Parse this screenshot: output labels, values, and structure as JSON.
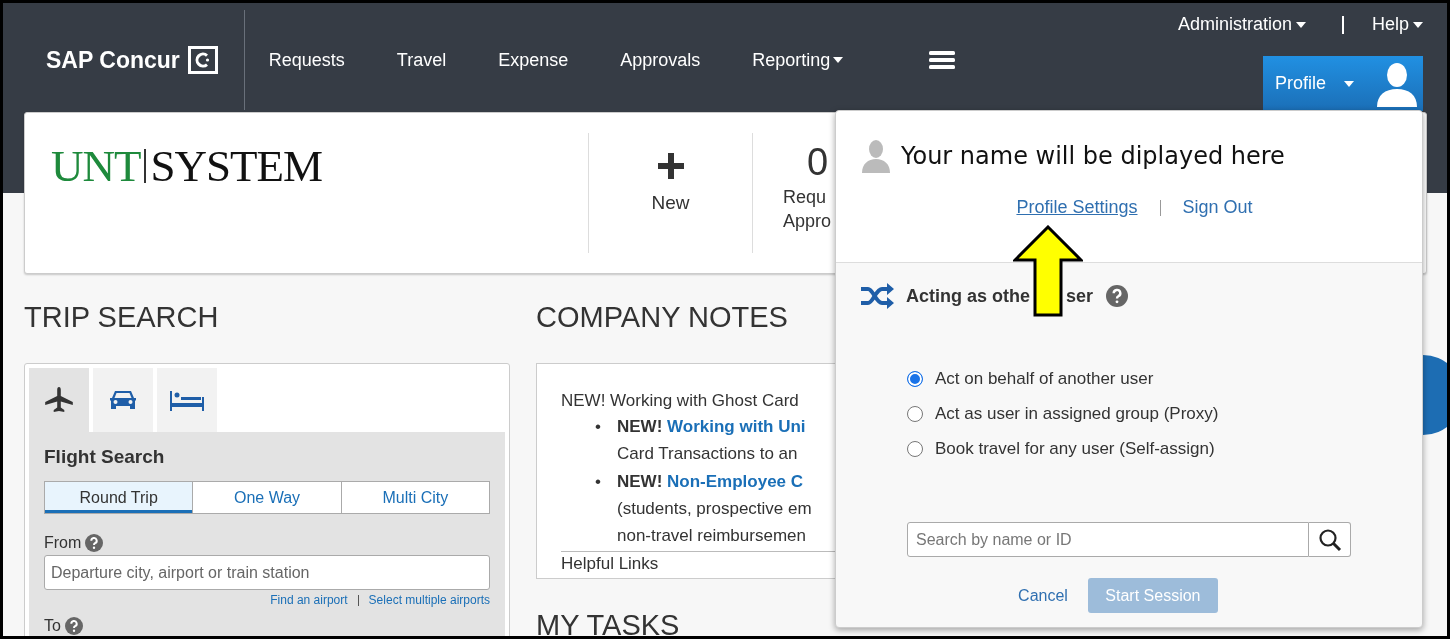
{
  "nav": {
    "brand": "SAP Concur",
    "items": [
      {
        "label": "Requests",
        "dropdown": false
      },
      {
        "label": "Travel",
        "dropdown": false
      },
      {
        "label": "Expense",
        "dropdown": false
      },
      {
        "label": "Approvals",
        "dropdown": false
      },
      {
        "label": "Reporting",
        "dropdown": true
      }
    ],
    "utility": [
      {
        "label": "Administration",
        "dropdown": true
      },
      {
        "label": "Help",
        "dropdown": true
      }
    ],
    "profile_button": "Profile"
  },
  "header_card": {
    "logo": {
      "first": "UNT",
      "second": "SYSTEM"
    },
    "actions": [
      {
        "kind": "new",
        "lines": [
          "New"
        ]
      },
      {
        "kind": "count",
        "value": "0",
        "lines": [
          "Requ",
          "Appro"
        ]
      }
    ]
  },
  "trip_search": {
    "title": "TRIP SEARCH",
    "modes": [
      {
        "kind": "plane",
        "selected": true
      },
      {
        "kind": "car",
        "selected": false
      },
      {
        "kind": "hotel",
        "selected": false
      }
    ],
    "section_title": "Flight Search",
    "trip_types": [
      {
        "label": "Round Trip",
        "selected": true
      },
      {
        "label": "One Way",
        "selected": false
      },
      {
        "label": "Multi City",
        "selected": false
      }
    ],
    "from": {
      "label": "From",
      "placeholder": "Departure city, airport or train station"
    },
    "links": [
      "Find an airport",
      "Select multiple airports"
    ],
    "to": {
      "label": "To"
    }
  },
  "company_notes": {
    "title": "COMPANY NOTES",
    "intro": "NEW! Working with Ghost Card",
    "bullets": [
      {
        "marker": "•",
        "badge": "NEW!",
        "link": "Working with Uni",
        "lines": [
          "Card Transactions to an"
        ]
      },
      {
        "marker": "•",
        "badge": "NEW!",
        "link": "Non-Employee C",
        "lines": [
          "(students, prospective em",
          "non-travel reimbursemen"
        ]
      }
    ],
    "footer": "Helpful Links"
  },
  "my_tasks": {
    "title": "MY TASKS"
  },
  "profile_menu": {
    "name": "Your name will be diplayed here",
    "links": [
      "Profile Settings",
      "Sign Out"
    ],
    "acting_title": [
      "Acting as othe",
      "ser"
    ],
    "options": [
      {
        "label": "Act on behalf of another user",
        "selected": true
      },
      {
        "label": "Act as user in assigned group (Proxy)",
        "selected": false
      },
      {
        "label": "Book travel for any user (Self-assign)",
        "selected": false
      }
    ],
    "search": {
      "placeholder": "Search by name or ID"
    },
    "cancel": "Cancel",
    "start": {
      "label": "Start Session",
      "disabled": true
    }
  }
}
